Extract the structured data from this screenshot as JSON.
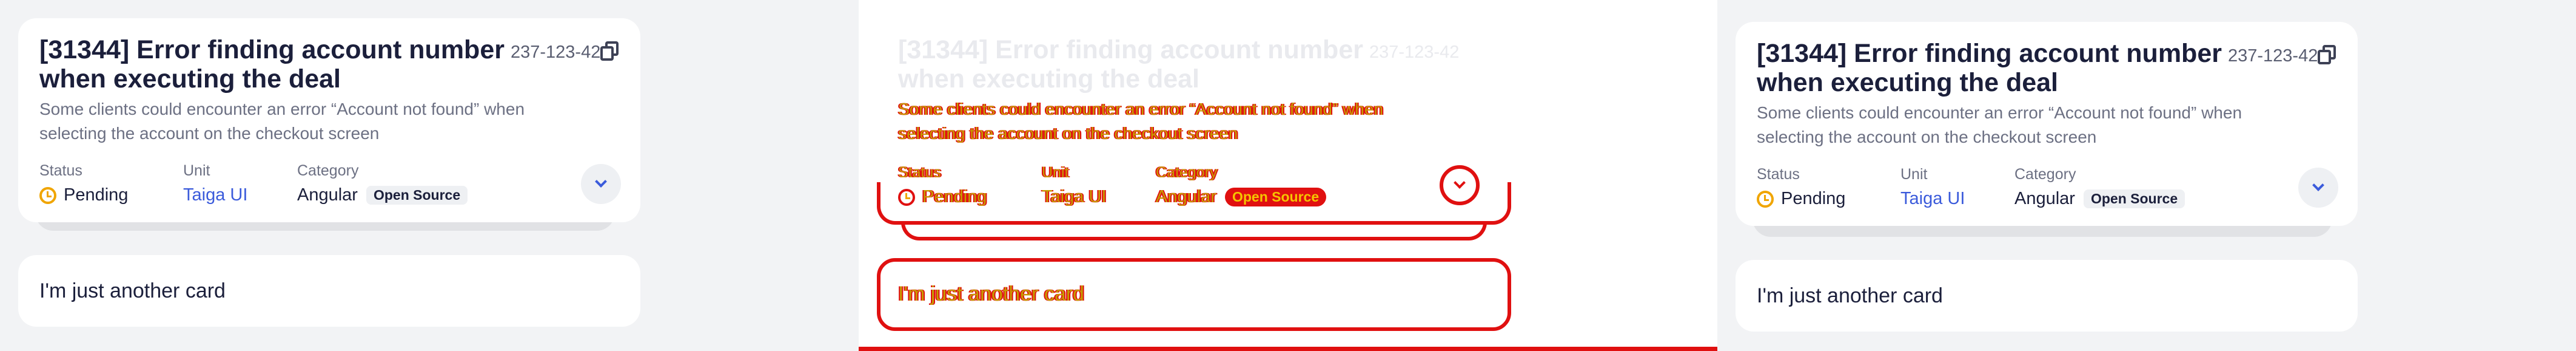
{
  "ticket": {
    "title": "[31344] Error finding account number when executing the deal",
    "code": "237-123-42",
    "description": "Some clients could encounter an error “Account not found” when selecting the account on the checkout screen",
    "status_label": "Status",
    "status_value": "Pending",
    "unit_label": "Unit",
    "unit_value": "Taiga UI",
    "category_label": "Category",
    "category_value": "Angular",
    "category_tag": "Open Source"
  },
  "second_card": {
    "text": "I'm just another card"
  },
  "colors": {
    "pending": "#f0a500",
    "link": "#3b5bdb",
    "highlight": "#e01010"
  },
  "icons": [
    "copy-icon",
    "clock-icon",
    "chevron-down-icon"
  ]
}
